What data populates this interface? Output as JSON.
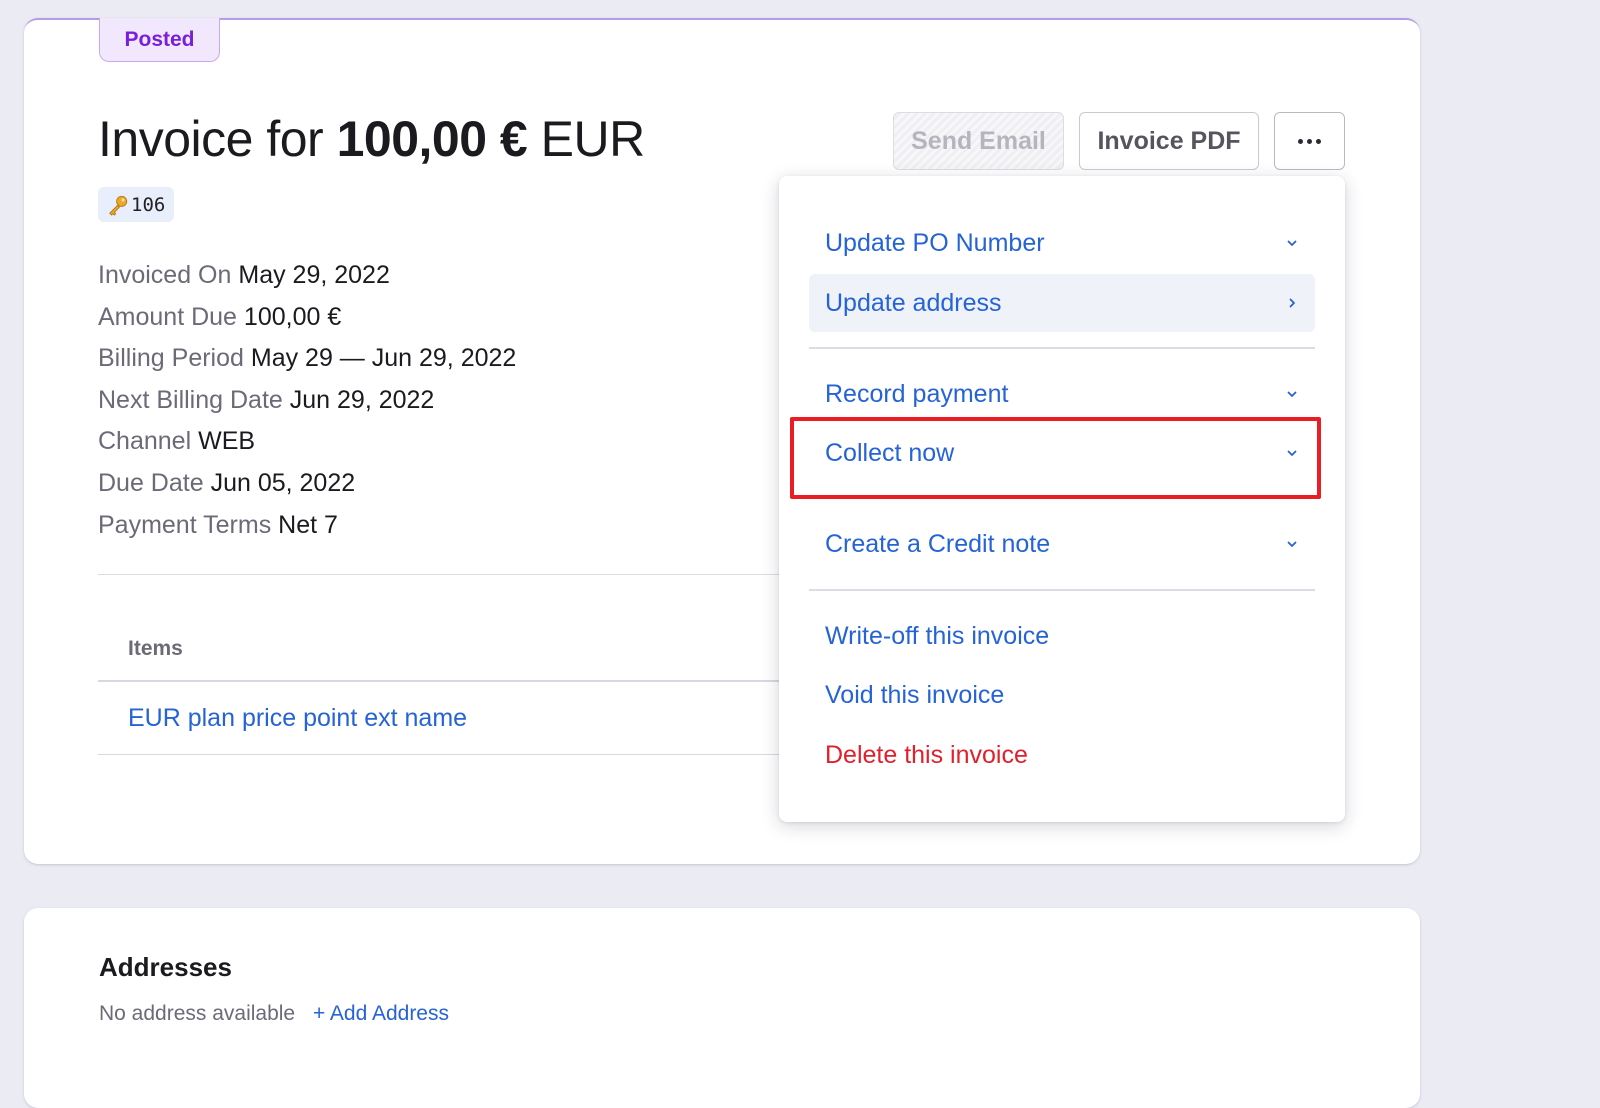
{
  "invoice": {
    "status": "Posted",
    "title_prefix": "Invoice for",
    "amount": "100,00 €",
    "currency": "EUR",
    "id": "106",
    "details": [
      {
        "label": "Invoiced On",
        "value": "May 29, 2022"
      },
      {
        "label": "Amount Due",
        "value": "100,00 €"
      },
      {
        "label": "Billing Period",
        "value": "May 29 — Jun 29, 2022"
      },
      {
        "label": "Next Billing Date",
        "value": "Jun 29, 2022"
      },
      {
        "label": "Channel",
        "value": "WEB"
      },
      {
        "label": "Due Date",
        "value": "Jun 05, 2022"
      },
      {
        "label": "Payment Terms",
        "value": "Net 7"
      }
    ],
    "items_header": "Items",
    "items": [
      {
        "name": "EUR plan price point ext name"
      }
    ]
  },
  "actions": {
    "send_email": "Send Email",
    "invoice_pdf": "Invoice PDF",
    "more_icon": "ellipsis-icon"
  },
  "menu": {
    "items": [
      {
        "label": "Update PO Number",
        "icon": "chevron-down-icon"
      },
      {
        "label": "Update address",
        "icon": "chevron-right-icon",
        "hovered": true
      },
      {
        "label": "Record payment",
        "icon": "chevron-down-icon"
      },
      {
        "label": "Collect now",
        "icon": "chevron-down-icon",
        "highlighted": true
      },
      {
        "label": "Create a Credit note",
        "icon": "chevron-down-icon"
      },
      {
        "label": "Write-off this invoice"
      },
      {
        "label": "Void this invoice"
      },
      {
        "label": "Delete this invoice",
        "danger": true
      }
    ]
  },
  "addresses": {
    "title": "Addresses",
    "empty": "No address available",
    "add": "+ Add Address"
  },
  "colors": {
    "link": "#2563d6",
    "danger": "#e2202c",
    "posted": "#7a1fd8",
    "highlight": "#ec1c24"
  }
}
